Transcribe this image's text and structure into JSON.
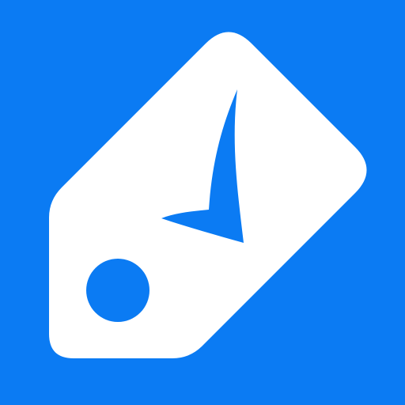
{
  "icon": {
    "name": "price-tag-checkmark",
    "background_color": "#0B7BF3",
    "tag_color": "#FFFFFF",
    "mark_color": "#0B7BF3"
  }
}
